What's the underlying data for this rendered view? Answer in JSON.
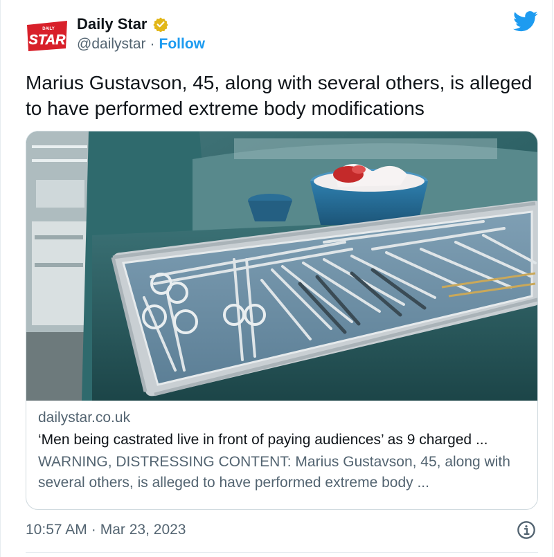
{
  "author": {
    "name": "Daily Star",
    "handle": "@dailystar",
    "separator": "·",
    "follow_label": "Follow",
    "avatar_logo_top": "DAILY",
    "avatar_logo_main": "STAR"
  },
  "icons": {
    "verified": "verified-badge-icon",
    "brand": "twitter-bird-icon",
    "info": "info-icon"
  },
  "colors": {
    "brand_blue": "#1d9bf0",
    "verified_gold": "#e2b719",
    "avatar_red": "#d8202a",
    "text_primary": "#0f1419",
    "text_secondary": "#536471"
  },
  "tweet": {
    "text": "Marius Gustavson, 45, along with several others, is alleged to have performed extreme body modifications"
  },
  "card": {
    "domain": "dailystar.co.uk",
    "title": "‘Men being castrated live in front of paying audiences’ as 9 charged ...",
    "description": "WARNING, DISTRESSING CONTENT: Marius Gustavson, 45, along with several others, is alleged to have performed extreme body ..."
  },
  "meta": {
    "time": "10:57 AM",
    "separator": "·",
    "date": "Mar 23, 2023"
  }
}
